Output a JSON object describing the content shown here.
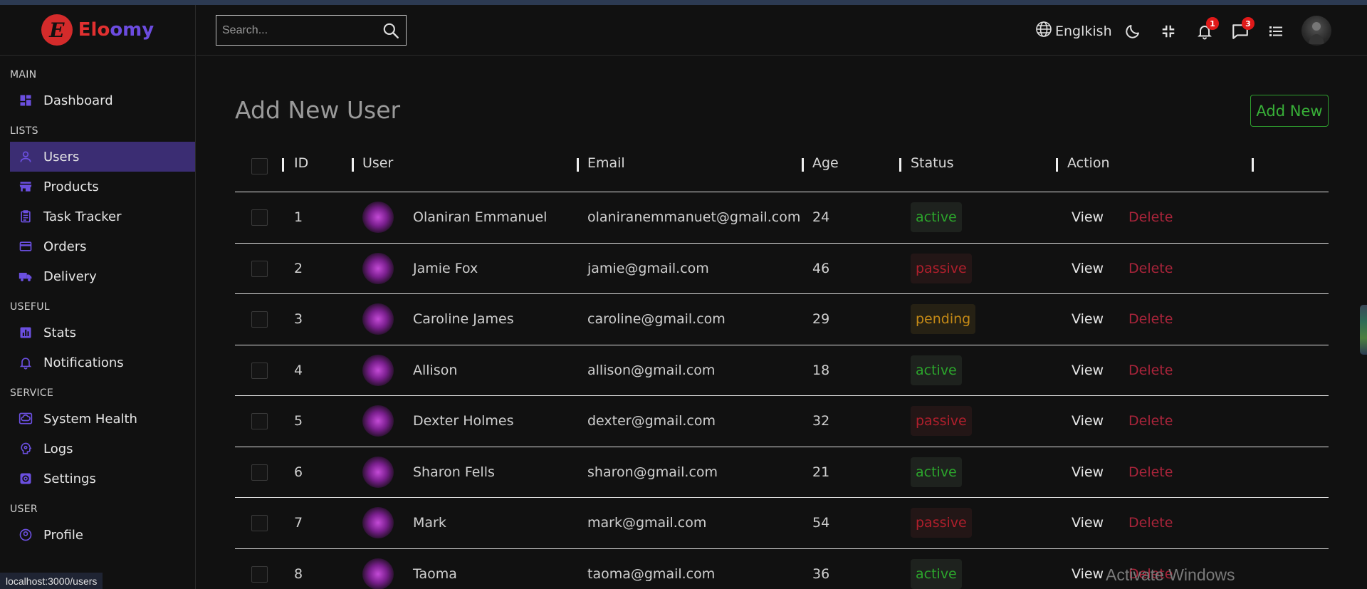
{
  "app": {
    "logo_letter": "E",
    "name_part1": "Elo",
    "name_part2": "omy"
  },
  "header": {
    "search_placeholder": "Search...",
    "language": "Englkish",
    "notifications_count": "1",
    "messages_count": "3"
  },
  "sidebar": {
    "sections": [
      {
        "title": "MAIN",
        "items": [
          {
            "label": "Dashboard",
            "icon": "dashboard-icon"
          }
        ]
      },
      {
        "title": "LISTS",
        "items": [
          {
            "label": "Users",
            "icon": "user-icon",
            "active": true
          },
          {
            "label": "Products",
            "icon": "store-icon"
          },
          {
            "label": "Task Tracker",
            "icon": "clipboard-icon"
          },
          {
            "label": "Orders",
            "icon": "credit-card-icon"
          },
          {
            "label": "Delivery",
            "icon": "truck-icon"
          }
        ]
      },
      {
        "title": "USEFUL",
        "items": [
          {
            "label": "Stats",
            "icon": "chart-icon"
          },
          {
            "label": "Notifications",
            "icon": "bell-icon"
          }
        ]
      },
      {
        "title": "SERVICE",
        "items": [
          {
            "label": "System Health",
            "icon": "cloud-icon"
          },
          {
            "label": "Logs",
            "icon": "brain-icon"
          },
          {
            "label": "Settings",
            "icon": "settings-icon"
          }
        ]
      },
      {
        "title": "USER",
        "items": [
          {
            "label": "Profile",
            "icon": "profile-icon"
          }
        ]
      }
    ]
  },
  "main": {
    "title": "Add New User",
    "add_button": "Add New",
    "columns": [
      "ID",
      "User",
      "Email",
      "Age",
      "Status",
      "Action"
    ],
    "view_label": "View",
    "delete_label": "Delete",
    "rows": [
      {
        "id": "1",
        "user": "Olaniran Emmanuel",
        "email": "olaniranemmanuet@gmail.com",
        "age": "24",
        "status": "active"
      },
      {
        "id": "2",
        "user": "Jamie Fox",
        "email": "jamie@gmail.com",
        "age": "46",
        "status": "passive"
      },
      {
        "id": "3",
        "user": "Caroline James",
        "email": "caroline@gmail.com",
        "age": "29",
        "status": "pending"
      },
      {
        "id": "4",
        "user": "Allison",
        "email": "allison@gmail.com",
        "age": "18",
        "status": "active"
      },
      {
        "id": "5",
        "user": "Dexter Holmes",
        "email": "dexter@gmail.com",
        "age": "32",
        "status": "passive"
      },
      {
        "id": "6",
        "user": "Sharon Fells",
        "email": "sharon@gmail.com",
        "age": "21",
        "status": "active"
      },
      {
        "id": "7",
        "user": "Mark",
        "email": "mark@gmail.com",
        "age": "54",
        "status": "passive"
      },
      {
        "id": "8",
        "user": "Taoma",
        "email": "taoma@gmail.com",
        "age": "36",
        "status": "active"
      }
    ]
  },
  "status_bar": {
    "url": "localhost:3000/users"
  },
  "overlay": {
    "watermark": "Activate Windows"
  }
}
